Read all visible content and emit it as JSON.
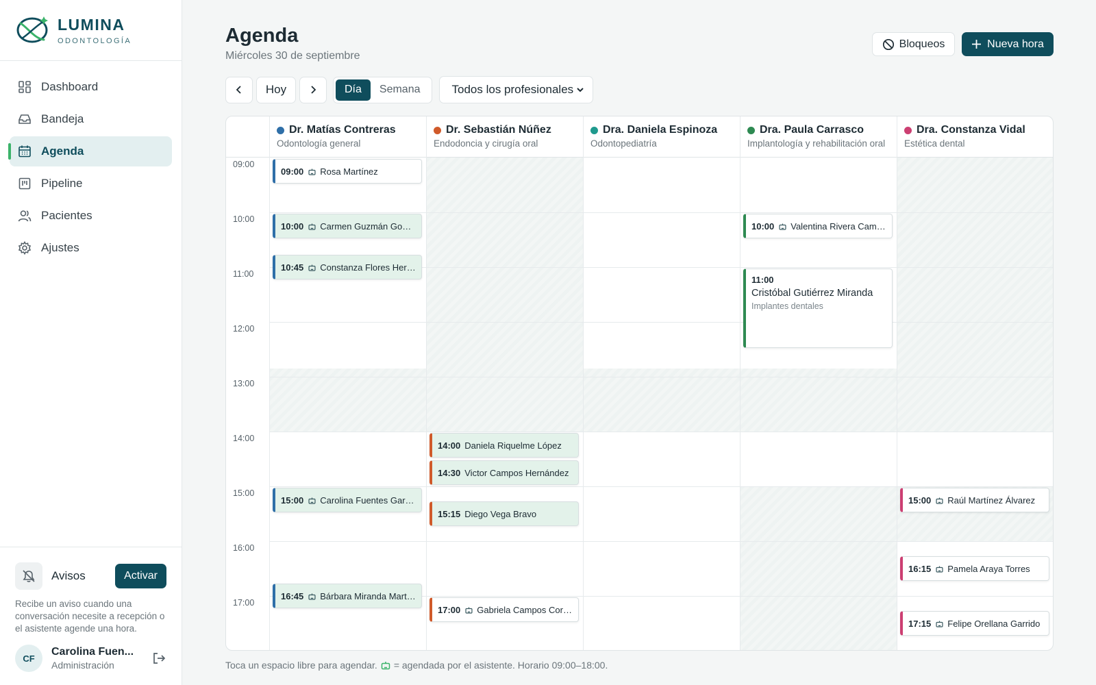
{
  "brand": {
    "name": "LUMINA",
    "subtitle": "ODONTOLOGÍA"
  },
  "sidebar": {
    "items": [
      {
        "label": "Dashboard",
        "icon": "dashboard-icon"
      },
      {
        "label": "Bandeja",
        "icon": "inbox-icon"
      },
      {
        "label": "Agenda",
        "icon": "calendar-icon",
        "active": true
      },
      {
        "label": "Pipeline",
        "icon": "pipeline-icon"
      },
      {
        "label": "Pacientes",
        "icon": "users-icon"
      },
      {
        "label": "Ajustes",
        "icon": "gear-icon"
      }
    ],
    "alerts": {
      "label": "Avisos",
      "button": "Activar",
      "description": "Recibe un aviso cuando una conversación necesite a recepción o el asistente agende una hora."
    },
    "user": {
      "initials": "CF",
      "name": "Carolina Fuen...",
      "role": "Administración"
    }
  },
  "header": {
    "title": "Agenda",
    "date": "Miércoles 30 de septiembre",
    "blocks_label": "Bloqueos",
    "new_label": "Nueva hora"
  },
  "toolbar": {
    "today": "Hoy",
    "view_day": "Día",
    "view_week": "Semana",
    "filter": "Todos los profesionales"
  },
  "colors": {
    "primary": "#0f4d5c",
    "accent": "#3bb36a"
  },
  "calendar": {
    "hours": [
      "09:00",
      "10:00",
      "11:00",
      "12:00",
      "13:00",
      "14:00",
      "15:00",
      "16:00",
      "17:00"
    ],
    "professionals": [
      {
        "name": "Dr. Matías Contreras",
        "specialty": "Odontología general",
        "color": "#2f6fa8",
        "appointments": [
          {
            "time": "09:00",
            "patient": "Rosa Martínez",
            "bot": true,
            "tinted": false
          },
          {
            "time": "10:00",
            "patient": "Carmen Guzmán Gonz...",
            "bot": true,
            "tinted": true
          },
          {
            "time": "10:45",
            "patient": "Constanza Flores Herr...",
            "bot": true,
            "tinted": true
          },
          {
            "time": "15:00",
            "patient": "Carolina Fuentes Garri...",
            "bot": true,
            "tinted": true
          },
          {
            "time": "16:45",
            "patient": "Bárbara Miranda Martí...",
            "bot": true,
            "tinted": true
          }
        ]
      },
      {
        "name": "Dr. Sebastián Núñez",
        "specialty": "Endodoncia y cirugía oral",
        "color": "#d05a2a",
        "appointments": [
          {
            "time": "14:00",
            "patient": "Daniela Riquelme López",
            "bot": false,
            "tinted": true
          },
          {
            "time": "14:30",
            "patient": "Victor Campos Hernández",
            "bot": false,
            "tinted": true
          },
          {
            "time": "15:15",
            "patient": "Diego Vega Bravo",
            "bot": false,
            "tinted": true
          },
          {
            "time": "17:00",
            "patient": "Gabriela Campos Cortés",
            "bot": true,
            "tinted": false
          }
        ]
      },
      {
        "name": "Dra. Daniela Espinoza",
        "specialty": "Odontopediatría",
        "color": "#1f9a8e",
        "appointments": []
      },
      {
        "name": "Dra. Paula Carrasco",
        "specialty": "Implantología y rehabilitación oral",
        "color": "#2e8a52",
        "appointments": [
          {
            "time": "10:00",
            "patient": "Valentina Rivera Camp...",
            "bot": true,
            "tinted": false
          },
          {
            "time": "11:00",
            "patient": "Cristóbal Gutiérrez Miranda",
            "service": "Implantes dentales",
            "bot": false,
            "tinted": false
          }
        ]
      },
      {
        "name": "Dra. Constanza Vidal",
        "specialty": "Estética dental",
        "color": "#cc3f72",
        "appointments": [
          {
            "time": "15:00",
            "patient": "Raúl Martínez Álvarez",
            "bot": true,
            "tinted": false
          },
          {
            "time": "16:15",
            "patient": "Pamela Araya Torres",
            "bot": true,
            "tinted": false
          },
          {
            "time": "17:15",
            "patient": "Felipe Orellana Garrido",
            "bot": true,
            "tinted": false
          }
        ]
      }
    ]
  },
  "footer": {
    "note_before": "Toca un espacio libre para agendar.",
    "note_after": "= agendada por el asistente. Horario 09:00–18:00."
  }
}
